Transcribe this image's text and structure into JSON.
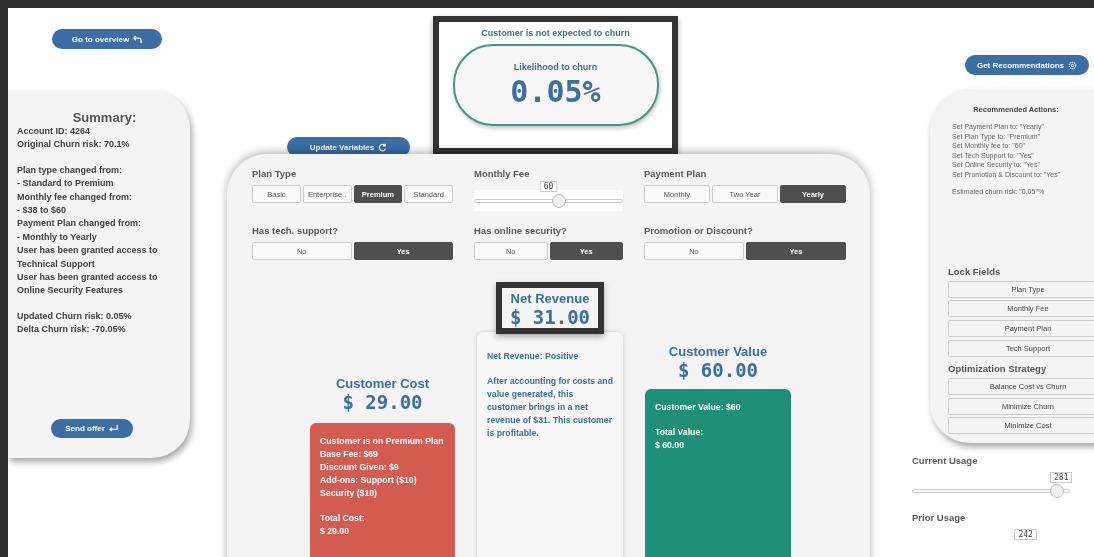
{
  "nav_button": {
    "label": "Go to overview"
  },
  "summary": {
    "title": "Summary:",
    "paragraphs": [
      [
        "Account ID: 4264",
        "Original Churn risk: 70.1%"
      ],
      [
        "Plan type changed from:",
        "- Standard to Premium",
        "Monthly fee changed from:",
        "- $38 to $60",
        "Payment Plan changed from:",
        "- Monthly to Yearly",
        "User has been granted access to",
        "Technical Support",
        "User has been granted access to",
        "Online Security Features"
      ],
      [
        "Updated Churn risk: 0.05%",
        "Delta Churn risk: -70.05%"
      ]
    ],
    "button": "Send offer"
  },
  "churn": {
    "status": "Customer is not expected to churn",
    "label": "Likelihood to churn",
    "value": "0.05%"
  },
  "update_button": "Update Variables",
  "controls": [
    {
      "kind": "segments",
      "label": "Plan Type",
      "options": [
        {
          "label": "Basic",
          "selected": false
        },
        {
          "label": "Enterprise..",
          "selected": false
        },
        {
          "label": "Premium",
          "selected": true
        },
        {
          "label": "Standard",
          "selected": false
        }
      ]
    },
    {
      "kind": "slider",
      "label": "Monthly Fee",
      "value": "60",
      "level": 0.57
    },
    {
      "kind": "segments",
      "label": "Payment Plan",
      "options": [
        {
          "label": "Monthly",
          "selected": false
        },
        {
          "label": "Two Year",
          "selected": false
        },
        {
          "label": "Yearly",
          "selected": true
        }
      ]
    },
    {
      "kind": "segments",
      "label": "Has tech. support?",
      "options": [
        {
          "label": "No",
          "selected": false
        },
        {
          "label": "Yes",
          "selected": true
        }
      ]
    },
    {
      "kind": "segments",
      "label": "Has online security?",
      "options": [
        {
          "label": "No",
          "selected": false
        },
        {
          "label": "Yes",
          "selected": true
        }
      ]
    },
    {
      "kind": "segments",
      "label": "Promotion or Discount?",
      "options": [
        {
          "label": "No",
          "selected": false
        },
        {
          "label": "Yes",
          "selected": true
        }
      ]
    }
  ],
  "metrics": [
    {
      "kind": "cost",
      "title": "Customer Cost",
      "amount": "$ 29.00",
      "paragraphs": [
        [
          "Customer is on Premium Plan",
          "Base Fee: $69",
          "Discount Given: $9",
          "Add-ons: Support ($10)",
          "Security ($10)"
        ],
        [
          "Total Cost:",
          "$ 29.00"
        ]
      ]
    },
    {
      "kind": "net",
      "title": "Net Revenue",
      "amount": "$ 31.00",
      "paragraphs": [
        [
          "Net Revenue: Positive"
        ],
        [
          "After accounting for costs and value generated, this customer brings in a net revenue of $31. This customer is profitable."
        ]
      ]
    },
    {
      "kind": "value",
      "title": "Customer Value",
      "amount": "$ 60.00",
      "paragraphs": [
        [
          "Customer Value: $60"
        ],
        [
          "Total Value:",
          "$ 60.00"
        ]
      ]
    }
  ],
  "recommend_button": "Get Recommendations",
  "recommendations": {
    "title": "Recommended Actions:",
    "paragraphs": [
      [
        "Set Payment Plan to: \"Yearly\"",
        "Set Plan Type to: \"Premium\"",
        "Set Monthly fee to: \"60\"",
        "Set Tech Support to: \"Yes\"",
        "Set Online Security to: \"Yes\"",
        "Set Promotion & Discount to: \"Yes\""
      ],
      [
        "Estimated churn risk: \"0.05\"%"
      ]
    ]
  },
  "lock_fields": {
    "title": "Lock Fields",
    "options": [
      "Plan Type",
      "Monthly Fee",
      "Payment Plan",
      "Tech Support"
    ]
  },
  "strategy": {
    "title": "Optimization Strategy",
    "options": [
      "Balance Cost vs Churn",
      "Minimize Churn",
      "Minimize Cost"
    ]
  },
  "usage": [
    {
      "label": "Current Usage",
      "value": "281",
      "level": 0.92
    },
    {
      "label": "Prior Usage",
      "value": "242"
    }
  ]
}
